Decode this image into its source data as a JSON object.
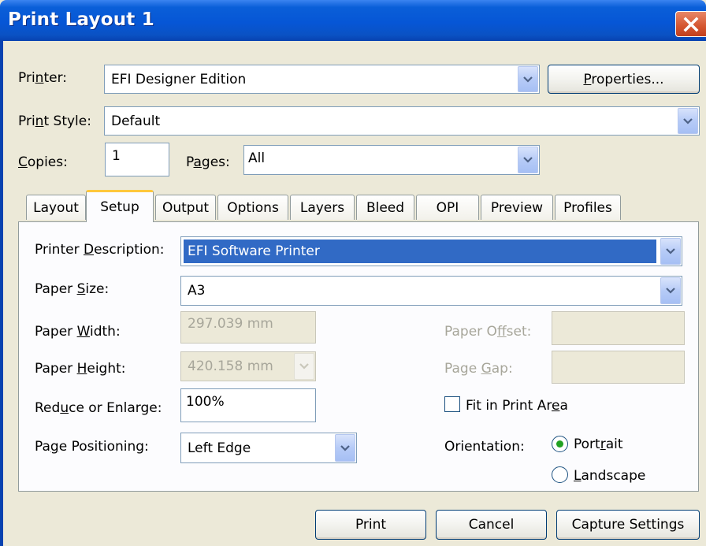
{
  "window": {
    "title": "Print Layout 1"
  },
  "printer": {
    "label_pre": "Pri",
    "label_acc": "n",
    "label_post": "ter:",
    "value": "EFI Designer Edition",
    "properties_button_acc": "P",
    "properties_button_rest": "roperties..."
  },
  "print_style": {
    "label_pre": "Pri",
    "label_acc": "n",
    "label_post": "t Style:",
    "value": "Default"
  },
  "copies": {
    "label_acc": "C",
    "label_rest": "opies:",
    "value": "1"
  },
  "pages": {
    "label_pre": "P",
    "label_acc": "a",
    "label_post": "ges:",
    "value": "All"
  },
  "tabs": [
    {
      "label": "Layout",
      "active": false
    },
    {
      "label": "Setup",
      "active": true
    },
    {
      "label": "Output",
      "active": false
    },
    {
      "label": "Options",
      "active": false
    },
    {
      "label": "Layers",
      "active": false
    },
    {
      "label": "Bleed",
      "active": false
    },
    {
      "label": "OPI",
      "active": false
    },
    {
      "label": "Preview",
      "active": false
    },
    {
      "label": "Profiles",
      "active": false
    }
  ],
  "setup": {
    "printer_description": {
      "label_pre": "Printer ",
      "label_acc": "D",
      "label_post": "escription:",
      "value": "EFI Software Printer"
    },
    "paper_size": {
      "label_pre": "Paper ",
      "label_acc": "S",
      "label_post": "ize:",
      "value": "A3"
    },
    "paper_width": {
      "label_pre": "Paper ",
      "label_acc": "W",
      "label_post": "idth:",
      "value": "297.039 mm"
    },
    "paper_height": {
      "label_pre": "Paper ",
      "label_acc": "H",
      "label_post": "eight:",
      "value": "420.158 mm"
    },
    "reduce_enlarge": {
      "label_pre": "Red",
      "label_acc": "u",
      "label_post": "ce or Enlarge:",
      "value": "100%"
    },
    "page_positioning": {
      "label_pre": "Pa",
      "label_acc": "g",
      "label_post": "e Positioning:",
      "value": "Left Edge"
    },
    "paper_offset": {
      "label_pre": "Paper O",
      "label_acc": "f",
      "label_post": "fset:",
      "value": ""
    },
    "page_gap": {
      "label_pre": "Page ",
      "label_acc": "G",
      "label_post": "ap:",
      "value": ""
    },
    "fit_in_print_area": {
      "label_pre": "Fit in Print Ar",
      "label_acc": "e",
      "label_post": "a",
      "checked": false
    },
    "orientation": {
      "label": "Orientation:",
      "portrait": {
        "label_pre": "Port",
        "label_acc": "r",
        "label_post": "ait",
        "selected": true
      },
      "landscape": {
        "label_pre": "",
        "label_acc": "L",
        "label_post": "andscape",
        "selected": false
      }
    }
  },
  "buttons": {
    "print": "Print",
    "cancel": "Cancel",
    "capture_settings": "Capture Settings"
  },
  "colors": {
    "titlebar": "#0656d6",
    "selection": "#316ac5",
    "dialog_bg": "#ECE9D8",
    "tab_highlight": "#ffc83c",
    "radio_dot": "#21a121"
  }
}
